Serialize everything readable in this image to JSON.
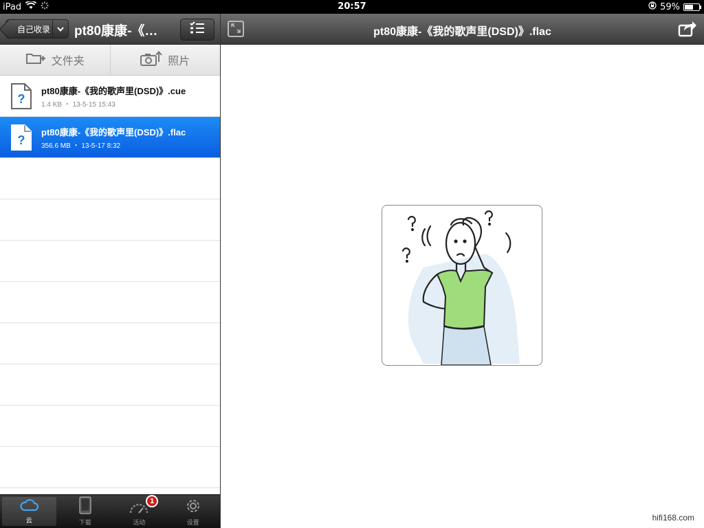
{
  "status_bar": {
    "device": "iPad",
    "time": "20:57",
    "battery_percent": "59%",
    "battery_level": 0.59
  },
  "left_nav": {
    "back_label": "自己收录",
    "title": "pt80康康-《…"
  },
  "toolbar": {
    "folder_label": "文件夹",
    "photo_label": "照片"
  },
  "files": [
    {
      "name": "pt80康康-《我的歌声里(DSD)》.cue",
      "meta": "1.4 KB ・ 13-5-15 15:43",
      "selected": false
    },
    {
      "name": "pt80康康-《我的歌声里(DSD)》.flac",
      "meta": "356.6 MB ・ 13-5-17 8:32",
      "selected": true
    }
  ],
  "tabs": [
    {
      "label": "云",
      "icon": "cloud-icon",
      "active": true
    },
    {
      "label": "下载",
      "icon": "tablet-icon",
      "active": false
    },
    {
      "label": "活动",
      "icon": "gauge-icon",
      "active": false,
      "badge": "1"
    },
    {
      "label": "设置",
      "icon": "gear-icon",
      "active": false
    }
  ],
  "right_nav": {
    "title": "pt80康康-《我的歌声里(DSD)》.flac"
  },
  "preview": {
    "illustration": "confused-person-illustration"
  },
  "watermark": "hifi168.com",
  "colors": {
    "selection": "#0a6ee8",
    "navbar": "#4a4a4a",
    "badge": "#d51a1a"
  }
}
